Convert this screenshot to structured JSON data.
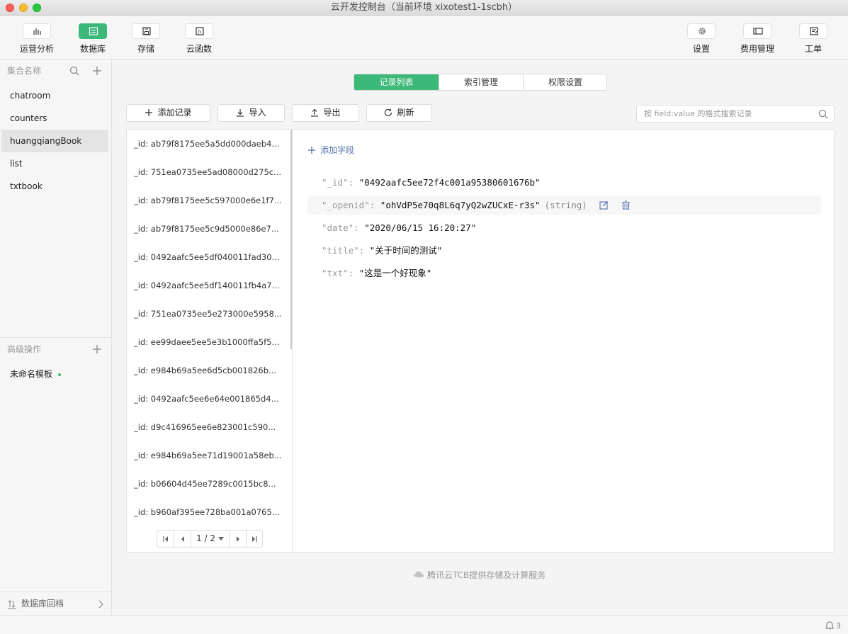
{
  "window": {
    "title": "云开发控制台（当前环境 xixotest1-1scbh）"
  },
  "toolbar": {
    "left": [
      {
        "label": "运营分析",
        "icon": "bar-chart-icon",
        "active": false
      },
      {
        "label": "数据库",
        "icon": "database-icon",
        "active": true
      },
      {
        "label": "存储",
        "icon": "save-icon",
        "active": false
      },
      {
        "label": "云函数",
        "icon": "function-icon",
        "active": false
      }
    ],
    "right": [
      {
        "label": "设置",
        "icon": "gear-icon"
      },
      {
        "label": "费用管理",
        "icon": "billing-icon"
      },
      {
        "label": "工单",
        "icon": "ticket-icon"
      }
    ]
  },
  "sidebar": {
    "collections_header": "集合名称",
    "collections": [
      "chatroom",
      "counters",
      "huangqiangBook",
      "list",
      "txtbook"
    ],
    "selected_collection": "huangqiangBook",
    "advanced_header": "高级操作",
    "advanced_items": [
      {
        "label": "未命名模板",
        "status_color": "#3cb878"
      }
    ],
    "rollback_label": "数据库回档"
  },
  "tabs": [
    "记录列表",
    "索引管理",
    "权限设置"
  ],
  "active_tab": "记录列表",
  "actions": {
    "add_record": "添加记录",
    "import": "导入",
    "export": "导出",
    "refresh": "刷新"
  },
  "search": {
    "placeholder": "按 field:value 的格式搜索记录",
    "value": ""
  },
  "records": [
    "_id: ab79f8175ee5a5dd000daeb4...",
    "_id: 751ea0735ee5ad08000d275c...",
    "_id: ab79f8175ee5c597000e6e1f7...",
    "_id: ab79f8175ee5c9d5000e86e7...",
    "_id: 0492aafc5ee5df040011fad30...",
    "_id: 0492aafc5ee5df140011fb4a7...",
    "_id: 751ea0735ee5e273000e5958...",
    "_id: ee99daee5ee5e3b1000ffa5f5...",
    "_id: e984b69a5ee6d5cb001826b...",
    "_id: 0492aafc5ee6e64e001865d4...",
    "_id: d9c416965ee6e823001c590...",
    "_id: e984b69a5ee71d19001a58eb...",
    "_id: b06604d45ee7289c0015bc8...",
    "_id: b960af395ee728ba001a0765..."
  ],
  "pagination": {
    "page_label": "1 / 2"
  },
  "detail": {
    "add_field_label": "添加字段",
    "fields": [
      {
        "key": "\"_id\"",
        "value": "\"0492aafc5ee72f4c001a95380601676b\"",
        "type": ""
      },
      {
        "key": "\"_openid\"",
        "value": "\"ohVdP5e70q8L6q7yQ2wZUCxE-r3s\"",
        "type": "(string)"
      },
      {
        "key": "\"date\"",
        "value": "\"2020/06/15 16:20:27\"",
        "type": ""
      },
      {
        "key": "\"title\"",
        "value": "\"关于时间的测试\"",
        "type": ""
      },
      {
        "key": "\"txt\"",
        "value": "\"这是一个好现象\"",
        "type": ""
      }
    ]
  },
  "footer": {
    "note": "腾讯云TCB提供存储及计算服务"
  },
  "status": {
    "notification_count": "3"
  },
  "colors": {
    "accent": "#3cb878",
    "link": "#4e6ea8"
  }
}
